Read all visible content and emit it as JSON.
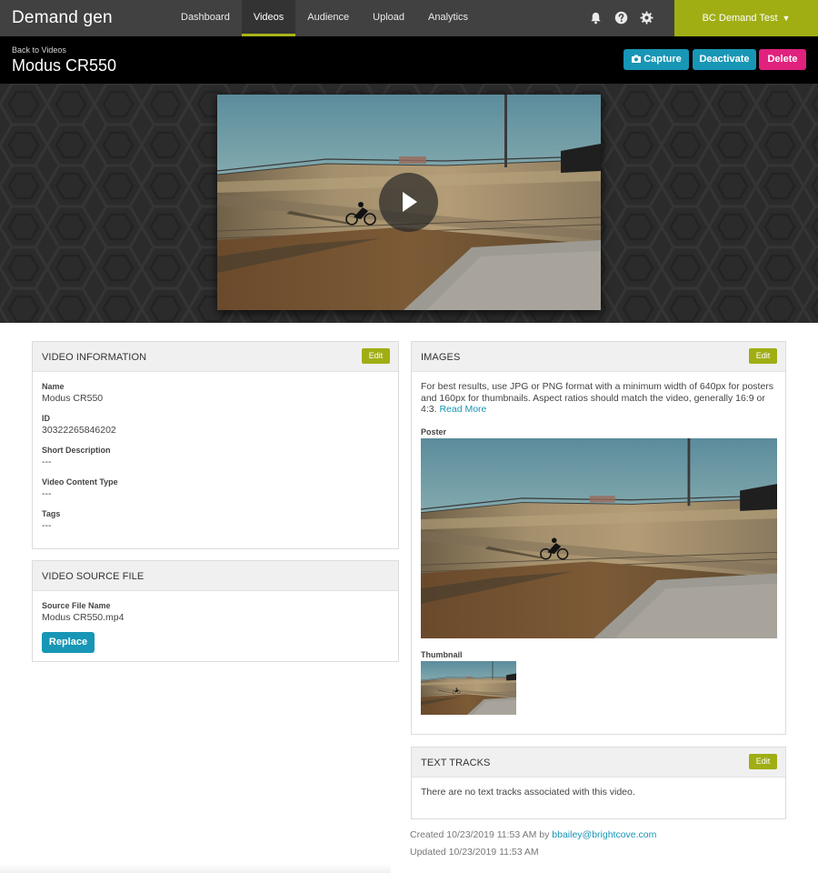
{
  "app": {
    "brand": "Demand gen",
    "account": "BC Demand Test",
    "account_caret": "▼"
  },
  "nav": {
    "items": [
      {
        "label": "Dashboard"
      },
      {
        "label": "Videos"
      },
      {
        "label": "Audience"
      },
      {
        "label": "Upload"
      },
      {
        "label": "Analytics"
      }
    ],
    "active": "Videos",
    "icons": [
      "bell-icon",
      "help-icon",
      "gear-icon"
    ]
  },
  "header": {
    "back_link": "Back to Videos",
    "title": "Modus CR550",
    "capture_label": "Capture",
    "deactivate_label": "Deactivate",
    "delete_label": "Delete"
  },
  "player": {
    "play_icon": "play-icon"
  },
  "video_info": {
    "heading": "VIDEO INFORMATION",
    "edit_label": "Edit",
    "name_label": "Name",
    "name_value": "Modus CR550",
    "id_label": "ID",
    "id_value": "30322265846202",
    "short_desc_label": "Short Description",
    "short_desc_value": "---",
    "content_type_label": "Video Content Type",
    "content_type_value": "---",
    "tags_label": "Tags",
    "tags_value": "---"
  },
  "source_file": {
    "heading": "VIDEO SOURCE FILE",
    "file_label": "Source File Name",
    "file_value": "Modus CR550.mp4",
    "replace_label": "Replace"
  },
  "images": {
    "heading": "IMAGES",
    "edit_label": "Edit",
    "note": "For best results, use JPG or PNG format with a minimum width of 640px for posters and 160px for thumbnails. Aspect ratios should match the video, generally 16:9 or 4:3.",
    "read_more": "Read More",
    "poster_label": "Poster",
    "thumbnail_label": "Thumbnail"
  },
  "text_tracks": {
    "heading": "TEXT TRACKS",
    "edit_label": "Edit",
    "empty_text": "There are no text tracks associated with this video."
  },
  "meta": {
    "created_prefix": "Created 10/23/2019 11:53 AM by",
    "created_by": "bbailey@brightcove.com",
    "updated": "Updated 10/23/2019 11:53 AM"
  },
  "colors": {
    "accent_green": "#a0ae14",
    "accent_blue": "#1896b5",
    "delete_pink": "#e0217e",
    "nav_bg": "#414141"
  }
}
